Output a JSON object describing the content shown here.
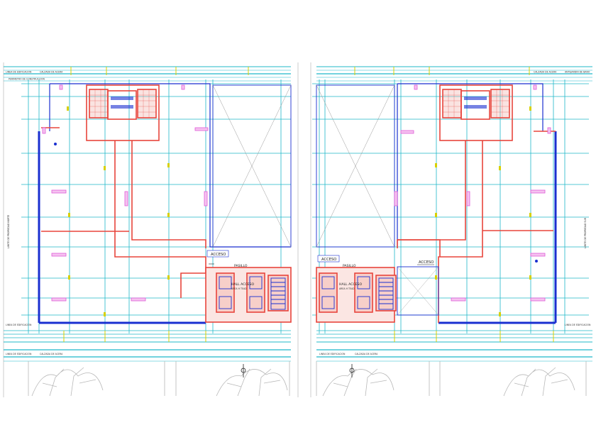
{
  "plans": [
    {
      "name": "left-plan",
      "street_top": "LINEA DE EDIFICACION",
      "street_top_mid": "CALZADA DE ACERA",
      "perimeter": "PERIMETRO DE CONSTRUCCION",
      "side_label": "LIMITE DE PROPIEDAD NORTE",
      "bottom_label": "LINEA DE EDIFICACION",
      "bottom_left": "LINEA DE EDIFICACION",
      "bottom_mid": "CALZADA DE ACERA",
      "access": "ACCESO",
      "pasillo": "PASILLO",
      "hall": "HALL ACCESO",
      "hall_sub": "AREA H TEAD"
    },
    {
      "name": "right-plan",
      "street_top": "ANTEJARDIN DE BANO",
      "street_top_mid": "CALZADA DE ACERA",
      "side_label": "LIMITE DE PROPIEDAD SUR",
      "bottom_label": "LINEA DE EDIFICACION",
      "bottom_left": "LINEA DE EDIFICACION",
      "bottom_mid": "CALZADA DE ACERA",
      "access": "ACCESO",
      "access2": "ACCESO",
      "pasillo": "PASILLO",
      "hall": "HALL ACCESO",
      "hall_sub": "AREA H TEAD"
    }
  ],
  "colors": {
    "grid": "#1fb8c9",
    "wall": "#e8453c",
    "wall_fill": "#f2b0a8",
    "facade": "#1a2fd0",
    "magenta": "#e05ad8",
    "tree": "#b8b8b8",
    "yellow": "#d8d000"
  }
}
